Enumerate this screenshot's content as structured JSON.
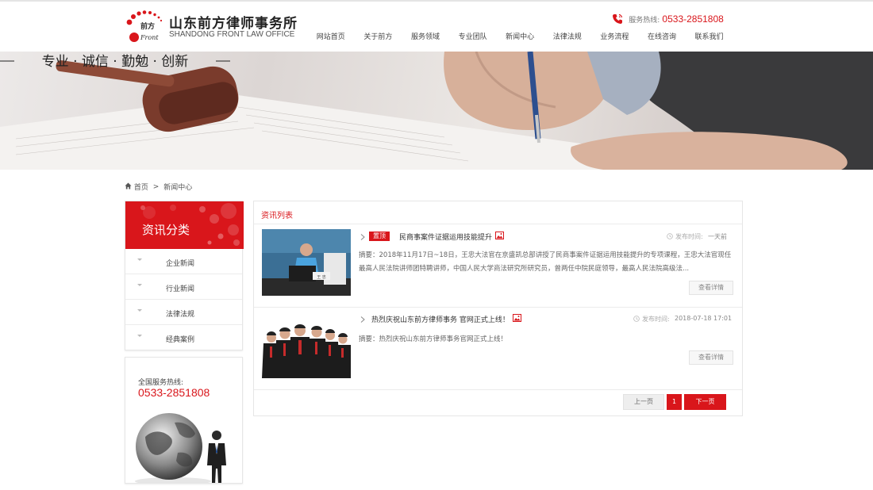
{
  "header": {
    "logo_mark": "前方",
    "logo_mark_en": "Front",
    "logo_cn": "山东前方律师事务所",
    "logo_en": "SHANDONG FRONT LAW OFFICE",
    "hotline_label": "服务热线:",
    "hotline_number": "0533-2851808"
  },
  "nav": {
    "items": [
      {
        "label": "网站首页"
      },
      {
        "label": "关于前方"
      },
      {
        "label": "服务领域"
      },
      {
        "label": "专业团队"
      },
      {
        "label": "新闻中心"
      },
      {
        "label": "法律法规"
      },
      {
        "label": "业务流程"
      },
      {
        "label": "在线咨询"
      },
      {
        "label": "联系我们"
      }
    ]
  },
  "banner": {
    "slogan": "专业 · 诚信 · 勤勉 · 创新"
  },
  "breadcrumb": {
    "home": "首页",
    "separator": ">",
    "current": "新闻中心"
  },
  "sidebar": {
    "category_title": "资讯分类",
    "categories": [
      {
        "label": "企业新闻"
      },
      {
        "label": "行业新闻"
      },
      {
        "label": "法律法规"
      },
      {
        "label": "经典案例"
      }
    ],
    "contact_label": "全国服务热线:",
    "contact_number": "0533-2851808"
  },
  "main": {
    "title": "资讯列表",
    "news": [
      {
        "badge": "置顶",
        "title": "民商事案件证据运用技能提升",
        "date_label": "发布时间:",
        "date": "一天前",
        "summary": "摘要：2018年11月17日~18日，王忠大法官在京盛凯总部讲授了民商事案件证据运用技能提升的专项课程，王忠大法官现任最高人民法院讲师团特聘讲师，中国人民大学商法研究所研究员，曾两任中院民庭领导，最高人民法院高级法...",
        "more": "查看详情"
      },
      {
        "badge": "",
        "title": "热烈庆祝山东前方律师事务 官网正式上线！",
        "date_label": "发布时间:",
        "date": "2018-07-18 17:01",
        "summary": "摘要：热烈庆祝山东前方律师事务官网正式上线！",
        "more": "查看详情"
      }
    ],
    "pager": {
      "prev": "上一页",
      "current_page": "1",
      "next": "下一页"
    }
  },
  "colors": {
    "brand_red": "#d9161b"
  },
  "icons": [
    "phone-icon",
    "home-icon",
    "chevron-right-icon",
    "image-icon",
    "clock-icon"
  ]
}
